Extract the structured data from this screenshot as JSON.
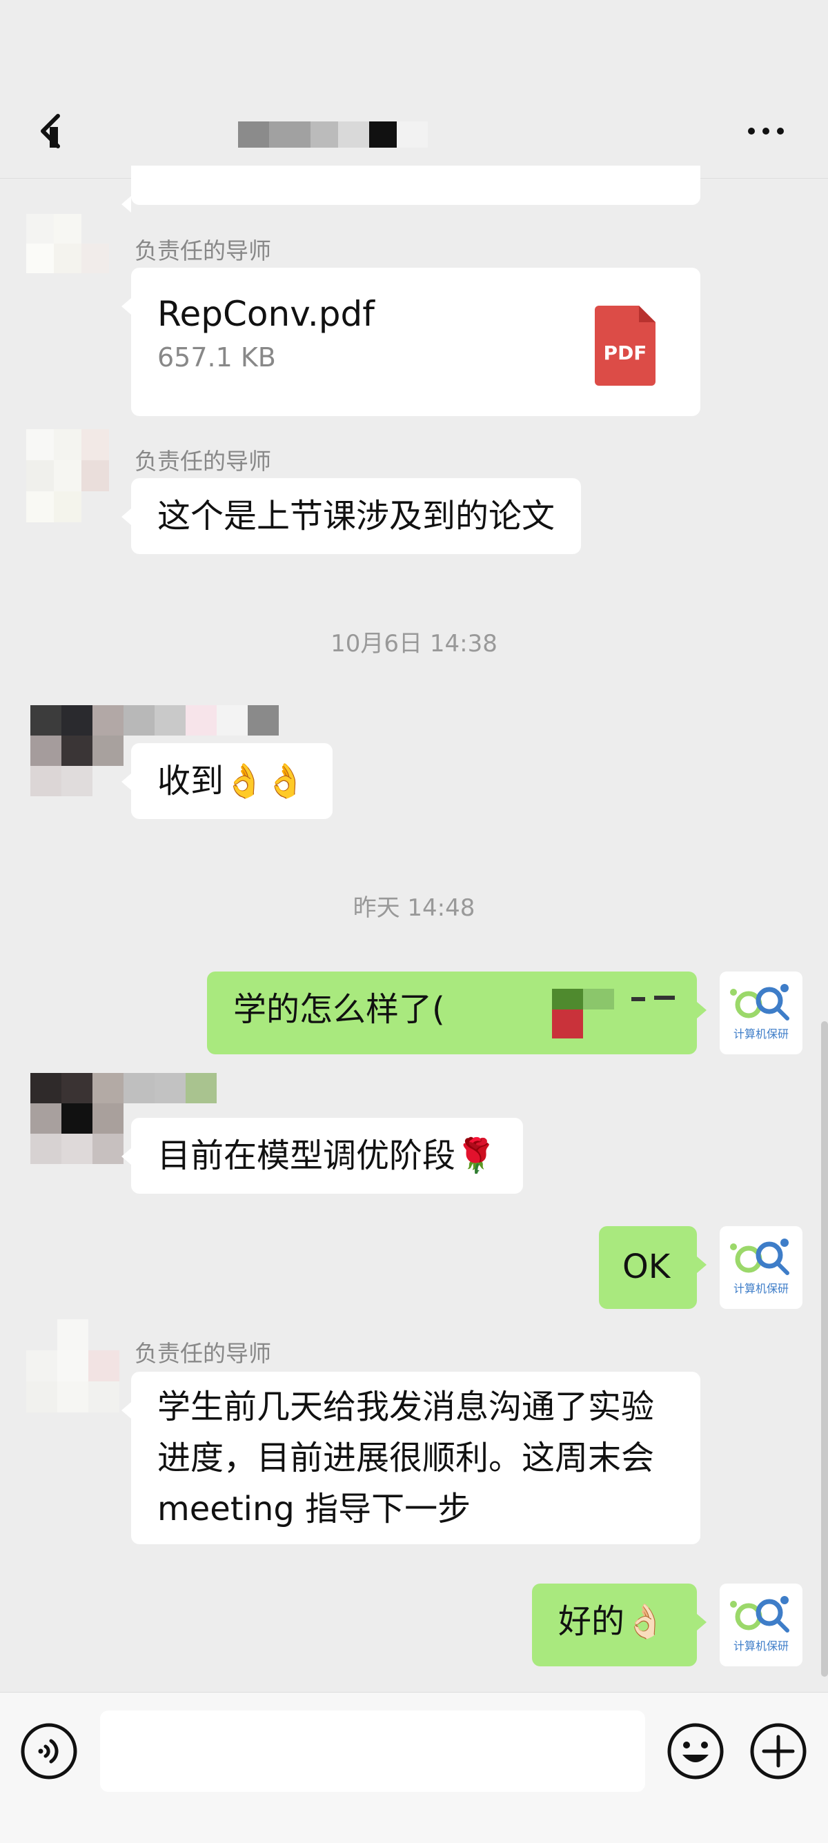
{
  "header": {
    "back_icon": "chevron-left-icon",
    "more_icon": "more-dots-icon"
  },
  "messages": {
    "top_partial": {
      "direction": "incoming"
    },
    "file_msg": {
      "sender": "负责任的导师",
      "file_name": "RepConv.pdf",
      "file_size": "657.1 KB",
      "file_badge": "PDF",
      "badge_color": "#dc4c47"
    },
    "paper_msg": {
      "sender": "负责任的导师",
      "text": "这个是上节课涉及到的论文"
    },
    "ts1": "10月6日 14:38",
    "received_msg": {
      "text": "收到👌👌"
    },
    "ts2": "昨天 14:48",
    "out_question": {
      "text": "学的怎么样了("
    },
    "tuning_msg": {
      "text": "目前在模型调优阶段🌹"
    },
    "out_ok": {
      "text": "OK"
    },
    "progress_msg": {
      "sender": "负责任的导师",
      "text": "学生前几天给我发消息沟通了实验进度，目前进展很顺利。这周末会 meeting 指导下一步"
    },
    "out_good": {
      "text": "好的👌🏻"
    }
  },
  "brand_avatar": {
    "label": "计算机保研",
    "accent_green": "#9bd86a",
    "accent_blue": "#3e7dc8"
  },
  "input_bar": {
    "voice_icon": "voice-icon",
    "emoji_icon": "emoji-icon",
    "plus_icon": "plus-icon"
  },
  "colors": {
    "background": "#ededed",
    "outgoing_bubble": "#a9e97e",
    "incoming_bubble": "#ffffff"
  }
}
